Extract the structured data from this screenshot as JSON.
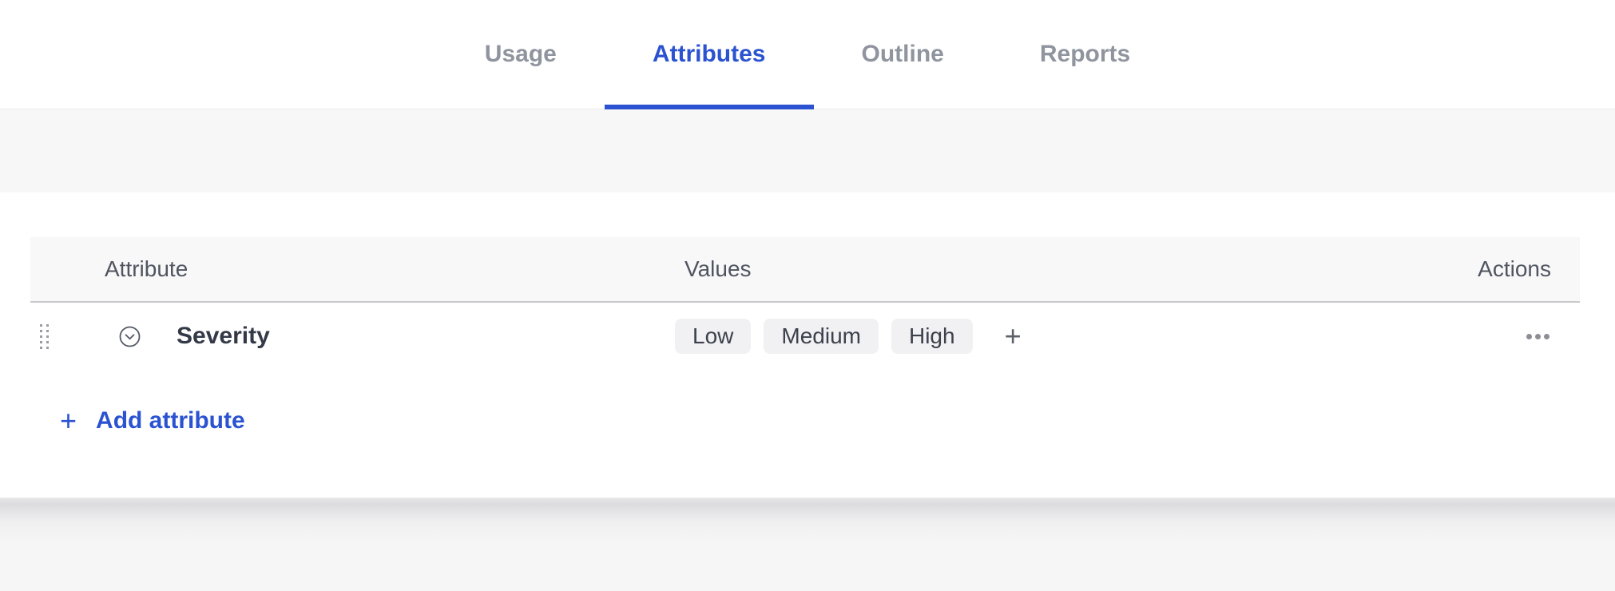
{
  "tabs": {
    "active_tab": "Attributes",
    "items": [
      {
        "label": "Usage"
      },
      {
        "label": "Attributes"
      },
      {
        "label": "Outline"
      },
      {
        "label": "Reports"
      }
    ]
  },
  "attributes_table": {
    "columns": {
      "attribute": "Attribute",
      "values": "Values",
      "actions": "Actions"
    },
    "rows": [
      {
        "attribute": "Severity",
        "values": [
          "Low",
          "Medium",
          "High"
        ]
      }
    ]
  },
  "buttons": {
    "add_attribute_label": "Add attribute",
    "plus_icon": "+"
  },
  "colors": {
    "accent_blue": "#2b53d1",
    "inactive_tab_gray": "#8f949e",
    "header_text_gray": "#4f5560",
    "chip_background": "#f1f1f3",
    "band_background": "#f7f7f8"
  }
}
